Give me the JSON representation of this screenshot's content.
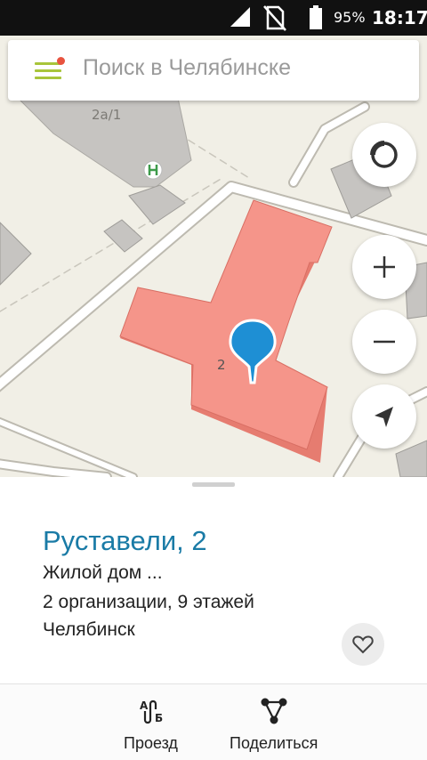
{
  "status_bar": {
    "battery": "95%",
    "time": "18:17"
  },
  "search": {
    "placeholder": "Поиск в Челябинске"
  },
  "map": {
    "building_label_top": "2а/1",
    "building_number": "2"
  },
  "place_card": {
    "title": "Руставели, 2",
    "description": "Жилой дом ...",
    "details": "2 организации, 9 этажей",
    "city": "Челябинск"
  },
  "actions": {
    "route_label": "Проезд",
    "share_label": "Поделиться"
  },
  "colors": {
    "accent_blue": "#1a7ba6",
    "pin_blue": "#1e8fd4",
    "highlight_building": "#f5958a",
    "menu_green": "#a8c53a",
    "notification_dot": "#e8533f"
  },
  "icons": [
    "signal-icon",
    "no-sim-icon",
    "battery-icon",
    "menu-icon",
    "compass-icon",
    "zoom-in-icon",
    "zoom-out-icon",
    "my-location-icon",
    "map-pin-icon",
    "service-poi-icon",
    "heart-icon",
    "route-icon",
    "share-icon"
  ]
}
